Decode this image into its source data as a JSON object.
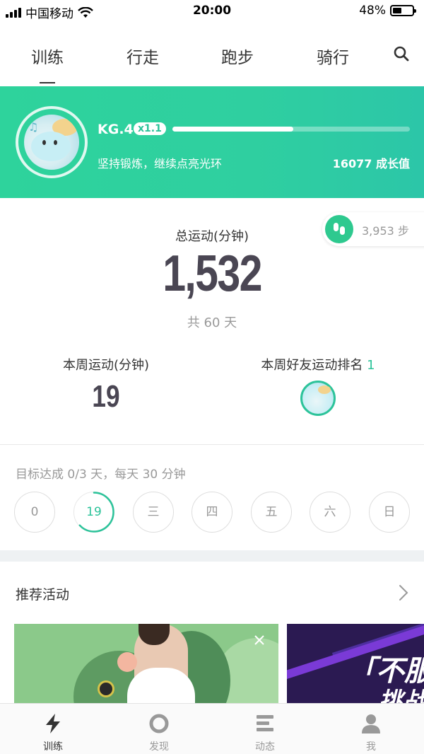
{
  "status_bar": {
    "carrier": "中国移动",
    "time": "20:00",
    "battery": "48%",
    "battery_level": 0.48
  },
  "tabs": [
    "训练",
    "行走",
    "跑步",
    "骑行"
  ],
  "active_tab": 0,
  "banner": {
    "level": "KG.4",
    "multiplier": "x1.1",
    "progress": 0.51,
    "motto": "坚持锻炼，继续点亮光环",
    "growth": "16077 成长值"
  },
  "steps": "3,953 步",
  "totals": {
    "label": "总运动(分钟)",
    "value": "1,532",
    "days": "共 60 天"
  },
  "weekly": {
    "label": "本周运动(分钟)",
    "value": "19",
    "rank_label": "本周好友运动排名",
    "rank_value": "1"
  },
  "goal": {
    "text": "目标达成 0/3 天，每天 30 分钟",
    "days": [
      "0",
      "19",
      "三",
      "四",
      "五",
      "六",
      "日"
    ],
    "active_index": 1,
    "active_progress": 0.63
  },
  "recommend": {
    "title": "推荐活动",
    "card2_text_1": "「不服",
    "card2_text_2": "挑战"
  },
  "bottom_nav": [
    "训练",
    "发现",
    "动态",
    "我"
  ],
  "colors": {
    "accent": "#2cc39a",
    "banner_start": "#2ed39c",
    "banner_end": "#2cc6a8",
    "numbers": "#4a4653"
  }
}
